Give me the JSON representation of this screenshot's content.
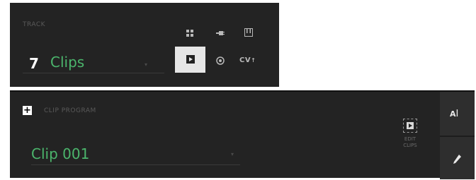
{
  "track": {
    "section_label": "TRACK",
    "number": "7",
    "name": "Clips",
    "type_buttons": {
      "drum": "drum-pads-icon",
      "plugin": "plugin-icon",
      "keygroup": "keygroup-icon",
      "clips": "clips-icon",
      "audio": "audio-icon",
      "cv_label": "CV"
    }
  },
  "clip_program": {
    "section_label": "CLIP PROGRAM",
    "add_icon": "+",
    "name": "Clip 001",
    "edit_label_line1": "EDIT",
    "edit_label_line2": "CLIPS"
  },
  "side": {
    "rename_label": "A",
    "edit_icon": "pencil-icon"
  },
  "colors": {
    "accent_green": "#4bb56c",
    "panel_bg": "#232323",
    "selected_bg": "#e6e6e6"
  }
}
